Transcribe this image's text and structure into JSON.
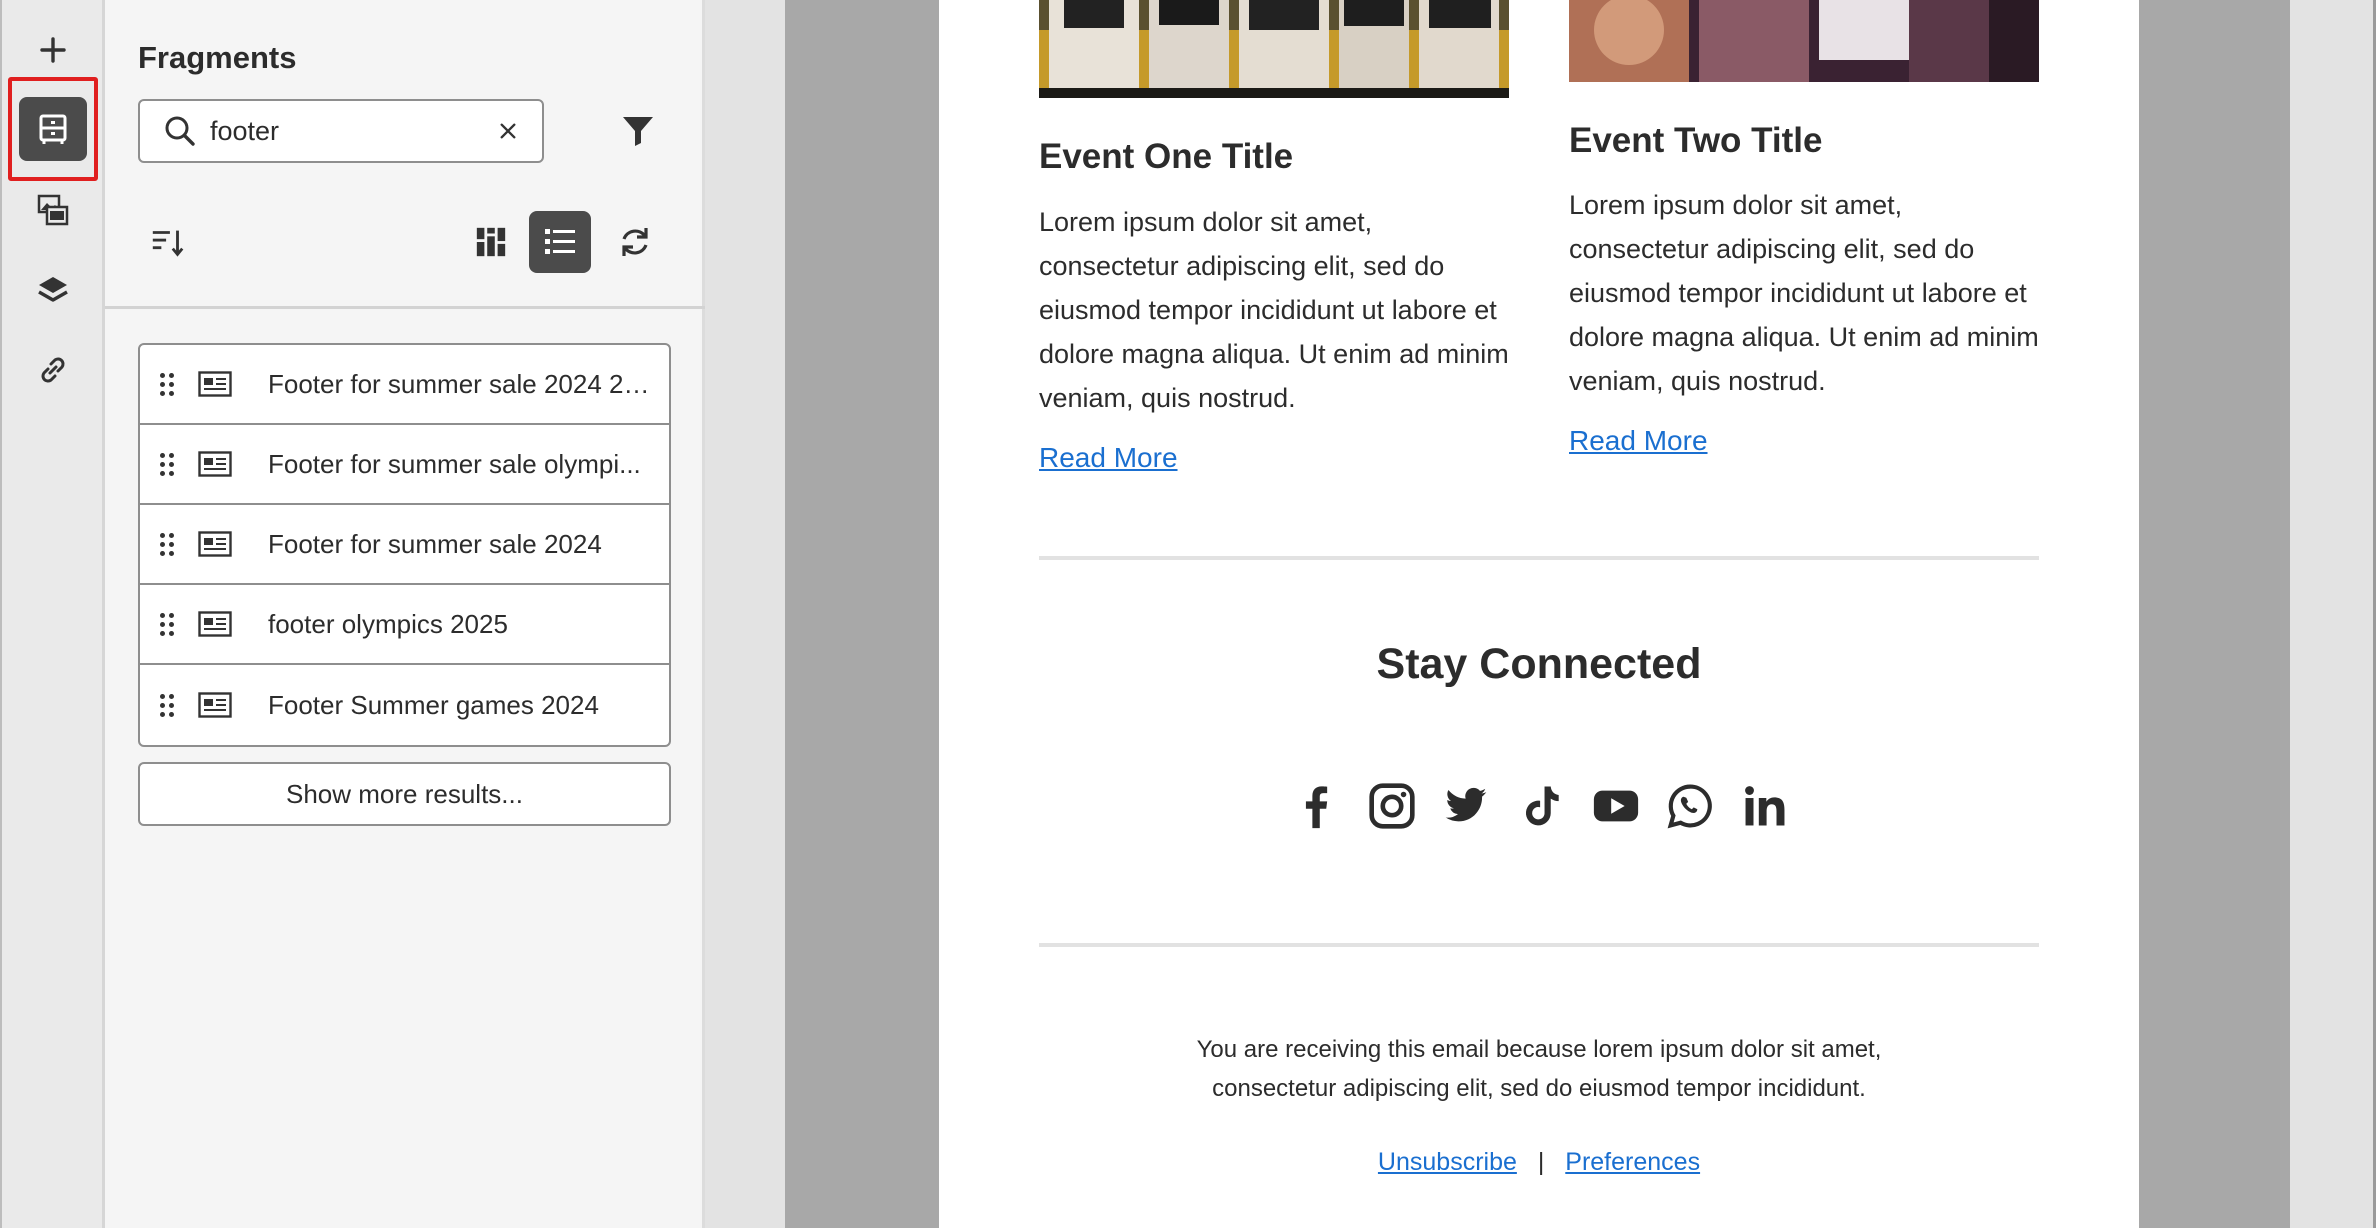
{
  "rail": {
    "items": [
      {
        "name": "add",
        "icon": "plus-icon"
      },
      {
        "name": "fragments",
        "icon": "fragments-icon",
        "active": true
      },
      {
        "name": "assets",
        "icon": "assets-icon"
      },
      {
        "name": "layers",
        "icon": "layers-icon"
      },
      {
        "name": "links",
        "icon": "link-icon"
      }
    ]
  },
  "panel": {
    "title": "Fragments",
    "search": {
      "value": "footer",
      "placeholder": ""
    },
    "results": [
      {
        "label": "Footer for summer sale 2024 20..."
      },
      {
        "label": "Footer for summer sale olympi..."
      },
      {
        "label": "Footer for summer sale 2024"
      },
      {
        "label": "footer olympics 2025"
      },
      {
        "label": "Footer Summer games 2024"
      }
    ],
    "show_more": "Show more results..."
  },
  "email": {
    "events": [
      {
        "title": "Event One Title",
        "body": "Lorem ipsum dolor sit amet, consectetur adipiscing elit, sed do eiusmod tempor incididunt ut labore et dolore magna aliqua. Ut enim ad minim veniam, quis nostrud.",
        "link": "Read More"
      },
      {
        "title": "Event Two Title",
        "body": "Lorem ipsum dolor sit amet, consectetur adipiscing elit, sed do eiusmod tempor incididunt ut labore et dolore magna aliqua. Ut enim ad minim veniam, quis nostrud.",
        "link": "Read More"
      }
    ],
    "stay_connected": "Stay Connected",
    "socials": [
      "facebook-icon",
      "instagram-icon",
      "twitter-icon",
      "tiktok-icon",
      "youtube-icon",
      "whatsapp-icon",
      "linkedin-icon"
    ],
    "footer_text": "You are receiving this email because lorem ipsum dolor sit amet, consectetur adipiscing elit, sed do eiusmod tempor incididunt.",
    "unsubscribe": "Unsubscribe",
    "separator": "|",
    "preferences": "Preferences"
  },
  "colors": {
    "accent": "#e01f1f",
    "link": "#1a6fd0",
    "active_tool": "#4b4b4b"
  }
}
